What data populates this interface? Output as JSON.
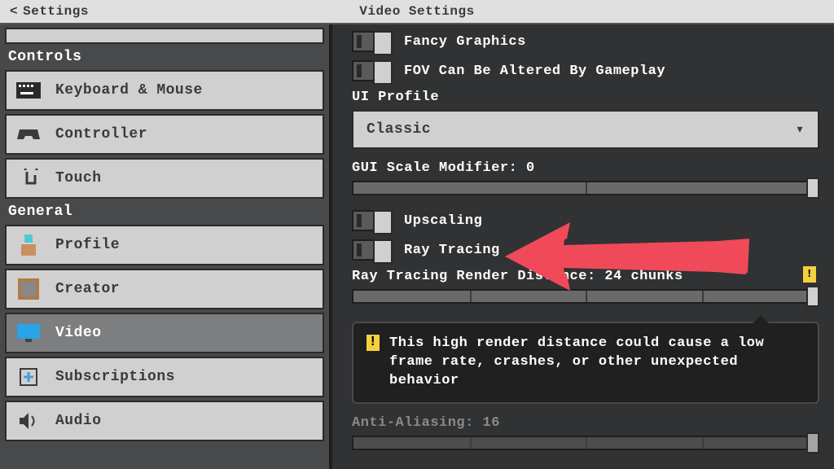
{
  "header": {
    "back_label": "Settings",
    "title": "Video Settings"
  },
  "sidebar": {
    "category_controls": "Controls",
    "category_general": "General",
    "items": {
      "keyboard": "Keyboard & Mouse",
      "controller": "Controller",
      "touch": "Touch",
      "profile": "Profile",
      "creator": "Creator",
      "video": "Video",
      "subscriptions": "Subscriptions",
      "audio": "Audio"
    }
  },
  "main": {
    "fancy_graphics": "Fancy Graphics",
    "fov_gameplay": "FOV Can Be Altered By Gameplay",
    "ui_profile_label": "UI Profile",
    "ui_profile_value": "Classic",
    "gui_scale_label": "GUI Scale Modifier: 0",
    "upscaling": "Upscaling",
    "ray_tracing": "Ray Tracing",
    "rt_render_dist_label": "Ray Tracing Render Distance: 24 chunks",
    "warning_text": "This high render distance could cause a low frame rate, crashes, or other unexpected behavior",
    "anti_aliasing_label": "Anti-Aliasing: 16"
  }
}
